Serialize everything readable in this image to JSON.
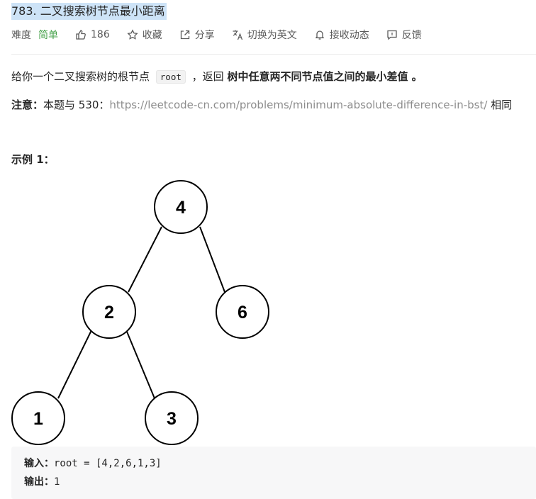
{
  "problem": {
    "title": "783. 二叉搜索树节点最小距离"
  },
  "meta": {
    "difficulty_label": "难度",
    "difficulty_value": "简单",
    "likes": "186",
    "favorite": "收藏",
    "share": "分享",
    "translate": "切换为英文",
    "notify": "接收动态",
    "feedback": "反馈",
    "difficulty_color": "#43a047"
  },
  "description": {
    "prefix": "给你一个二叉搜索树的根节点 ",
    "code": "root",
    "middle": " ，返回 ",
    "bold": "树中任意两不同节点值之间的最小差值",
    "suffix": " 。"
  },
  "note": {
    "label": "注意：",
    "text": "本题与 530：",
    "link": "https://leetcode-cn.com/problems/minimum-absolute-difference-in-bst/",
    "suffix": " 相同"
  },
  "example": {
    "title": "示例 1：",
    "tree_nodes": [
      "4",
      "2",
      "6",
      "1",
      "3"
    ],
    "input_label": "输入：",
    "input_value": "root = [4,2,6,1,3]",
    "output_label": "输出：",
    "output_value": "1"
  }
}
